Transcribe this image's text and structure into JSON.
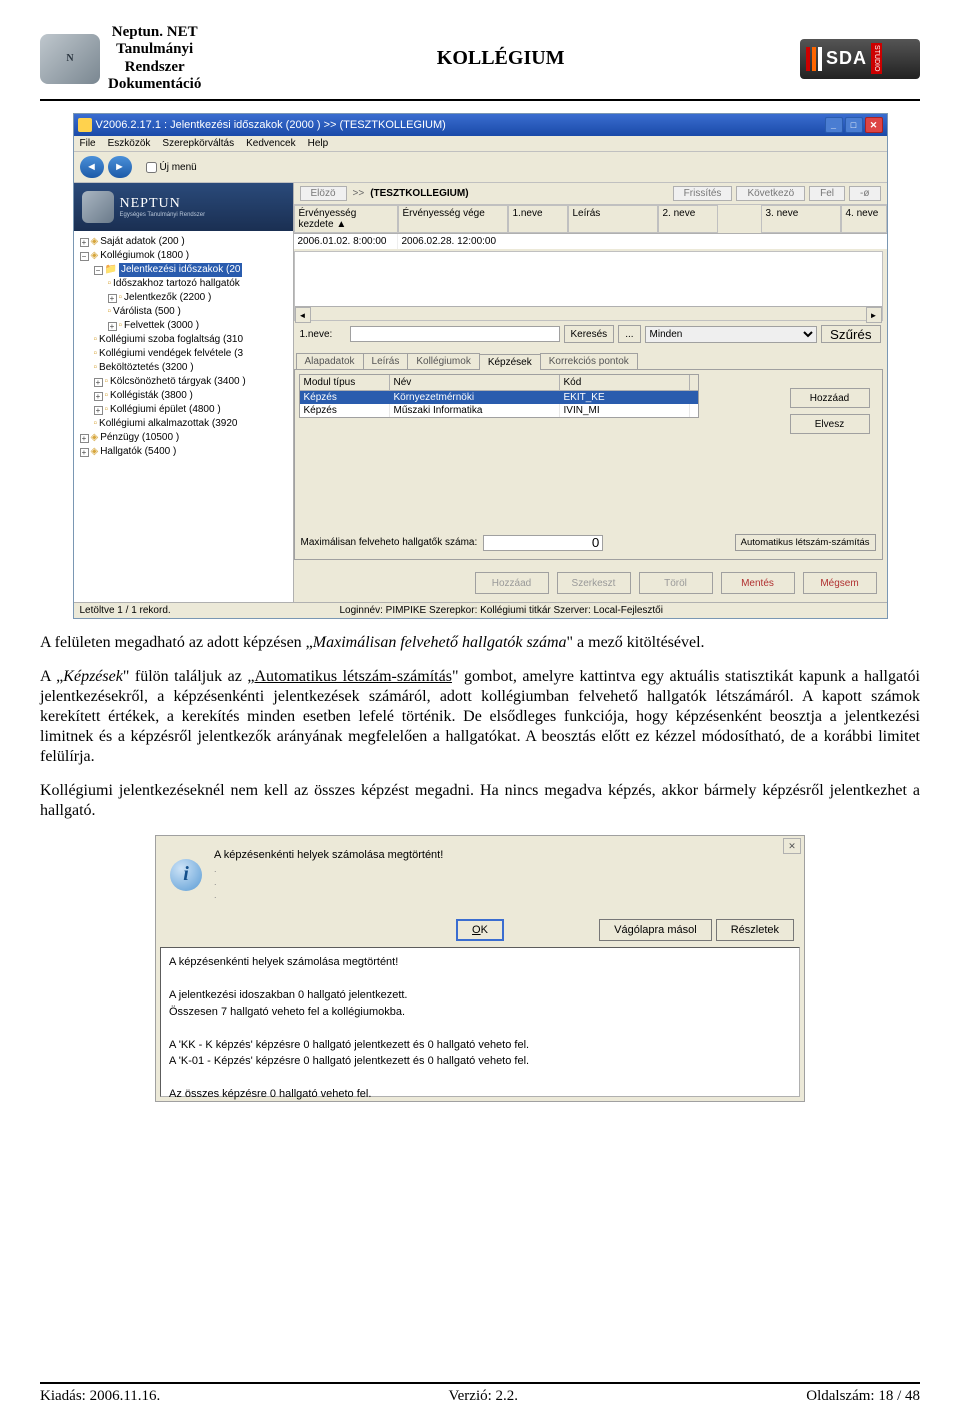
{
  "doc": {
    "title_lines": [
      "Neptun. NET",
      "Tanulmányi",
      "Rendszer",
      "Dokumentáció"
    ],
    "center": "KOLLÉGIUM",
    "sda": "SDA"
  },
  "app": {
    "titlebar": "V2006.2.17.1 : Jelentkezési időszakok (2000  )  >>  (TESZTKOLLEGIUM)",
    "menu": {
      "file": "File",
      "tools": "Eszközök",
      "roles": "Szerepkörváltás",
      "fav": "Kedvencek",
      "help": "Help"
    },
    "navback": "◄",
    "navfwd": "►",
    "ujmenu": "Új menü",
    "bc_btn": "Elözö",
    "bc_arrow": ">>",
    "bc_text": "(TESZTKOLLEGIUM)",
    "rbtns": {
      "frissit": "Frissítés",
      "kovetkezo": "Következö",
      "fel": "Fel",
      "neg": "-ø"
    },
    "gridhdrs": {
      "h1": "Érvényesség kezdete",
      "arrow": "▲",
      "h2": "Érvényesség vége",
      "h3": "1.neve",
      "h4": "Leírás",
      "h5": "2. neve",
      "h6": "3. neve",
      "h7": "4. neve"
    },
    "gridrow": {
      "c1": "2006.01.02. 8:00:00",
      "c2": "2006.02.28. 12:00:00"
    },
    "sidelogo": "NEPTUN",
    "sidelogo_sub": "Egységes Tanulmányi Rendszer",
    "tree": {
      "sajat": "Saját adatok (200  )",
      "kollegiumok": "Kollégiumok (1800  )",
      "jelido": "Jelentkezési időszakok (20",
      "idosz": "Időszakhoz tartozó hallgatók",
      "jelentkezok": "Jelentkezők (2200  )",
      "varolista": "Várólista (500  )",
      "felvettek": "Felvettek (3000  )",
      "szoba": "Kollégiumi szoba foglaltság (310",
      "vendeg": "Kollégiumi vendégek felvétele (3",
      "bekolt": "Beköltöztetés (3200  )",
      "kolcson": "Kölcsönözhetö tárgyak (3400  )",
      "kollegistak": "Kollégisták (3800  )",
      "epulet": "Kollégiumi épület (4800  )",
      "alkalm": "Kollégiumi alkalmazottak (3920",
      "penzugy": "Pénzügy (10500  )",
      "hallgatok": "Hallgatók (5400  )"
    },
    "filter": {
      "lbl": "1.neve:",
      "kereses": "Keresés",
      "dots": "...",
      "minden": "Minden",
      "szures": "Szűrés"
    },
    "tabs": {
      "alap": "Alapadatok",
      "leiras": "Leírás",
      "koll": "Kollégiumok",
      "kepz": "Képzések",
      "korr": "Korrekciós pontok"
    },
    "minihdr": {
      "a": "Modul típus",
      "b": "Név",
      "c": "Kód"
    },
    "minirows": [
      {
        "a": "Képzés",
        "b": "Környezetmérnöki",
        "c": "EKIT_KE"
      },
      {
        "a": "Képzés",
        "b": "Műszaki Informatika",
        "c": "IVIN_MI"
      }
    ],
    "sidebtns": {
      "add": "Hozzáad",
      "remove": "Elvesz"
    },
    "maxlabel": "Maximálisan felveheto hallgatők száma:",
    "maxval": "0",
    "auto": "Automatikus létszám-számítás",
    "bottom": {
      "hozzaad": "Hozzáad",
      "szerkeszt": "Szerkeszt",
      "torol": "Töröl",
      "mentes": "Mentés",
      "megsem": "Mégsem"
    },
    "status1": "Letöltve 1 / 1 rekord.",
    "status2": "Loginnév: PIMPIKE   Szerepkor: Kollégiumi titkár   Szerver: Local-Fejlesztői"
  },
  "text": {
    "p1_a": "A felületen megadható az adott képzésen „",
    "p1_b": "Maximálisan felvehető hallgatók száma",
    "p1_c": "\" a mező kitöltésével.",
    "p2_a": "A „",
    "p2_b": "Képzések",
    "p2_c": "\" fülön találjuk az „",
    "p2_d": "Automatikus létszám-számítás",
    "p2_e": "\" gombot, amelyre kattintva egy aktuális statisztikát kapunk a hallgatói jelentkezésekről, a képzésenkénti jelentkezések számáról, adott kollégiumban felvehető hallgatók létszámáról. A kapott számok kerekített értékek, a kerekítés minden esetben lefelé történik. De elsődleges funkciója, hogy képzésenként beosztja a jelentkezési limitnek és a képzésről jelentkezők arányának megfelelően a hallgatókat. A beosztás előtt ez kézzel módosítható, de a korábbi limitet felülírja.",
    "p3": "Kollégiumi jelentkezéseknél nem kell az összes képzést megadni. Ha nincs megadva képzés, akkor bármely képzésről jelentkezhet a hallgató."
  },
  "dialog": {
    "msg": "A képzésenkénti helyek számolása megtörtént!",
    "ok": "OK",
    "copy": "Vágólapra másol",
    "details": "Részletek",
    "d1": "A képzésenkénti helyek számolása megtörtént!",
    "d2": "A jelentkezési idoszakban 0 hallgató jelentkezett.",
    "d3": "Összesen 7 hallgató veheto fel a kollégiumokba.",
    "d4": "A 'KK - K képzés' képzésre 0 hallgató jelentkezett és 0 hallgató veheto fel.",
    "d5": "A 'K-01 - Képzés' képzésre 0 hallgató jelentkezett és 0 hallgató veheto fel.",
    "d6": "Az összes képzésre 0 hallgató veheto fel."
  },
  "footer": {
    "kiadas": "Kiadás: 2006.11.16.",
    "verzio": "Verzió: 2.2.",
    "oldal": "Oldalszám: 18 / 48"
  }
}
